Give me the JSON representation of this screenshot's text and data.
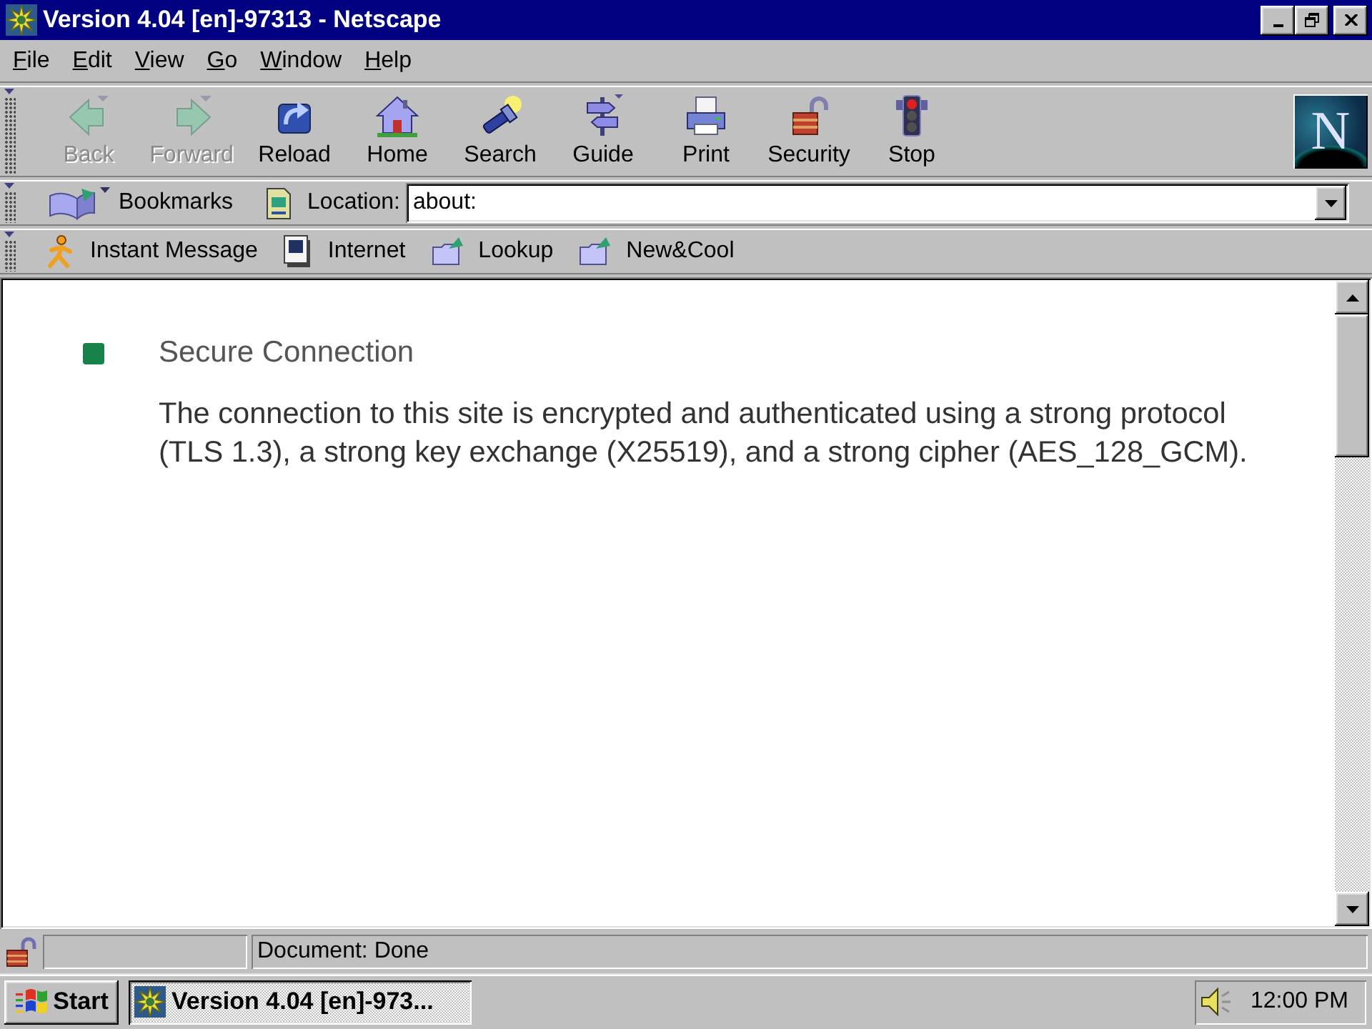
{
  "window": {
    "title": "Version 4.04 [en]-97313 - Netscape"
  },
  "menu_bar": [
    "File",
    "Edit",
    "View",
    "Go",
    "Window",
    "Help"
  ],
  "navigation_toolbar": [
    {
      "label": "Back",
      "disabled": true
    },
    {
      "label": "Forward",
      "disabled": true
    },
    {
      "label": "Reload",
      "disabled": false
    },
    {
      "label": "Home",
      "disabled": false
    },
    {
      "label": "Search",
      "disabled": false
    },
    {
      "label": "Guide",
      "disabled": false
    },
    {
      "label": "Print",
      "disabled": false
    },
    {
      "label": "Security",
      "disabled": false
    },
    {
      "label": "Stop",
      "disabled": false
    }
  ],
  "logo": {
    "letter": "N"
  },
  "location_bar": {
    "bookmarks_label": "Bookmarks",
    "location_label": "Location:",
    "value": "about:"
  },
  "personal_toolbar": [
    "Instant Message",
    "Internet",
    "Lookup",
    "New&Cool"
  ],
  "content": {
    "secure": true,
    "title": "Secure Connection",
    "description": "The connection to this site is encrypted and authenticated using a strong protocol (TLS 1.3), a strong key exchange (X25519), and a strong cipher (AES_128_GCM)."
  },
  "status_bar": {
    "text": "Document: Done"
  },
  "taskbar": {
    "start_label": "Start",
    "task": {
      "label": "Version 4.04 [en]-973...",
      "selected": true
    },
    "clock": "12:00 PM"
  }
}
